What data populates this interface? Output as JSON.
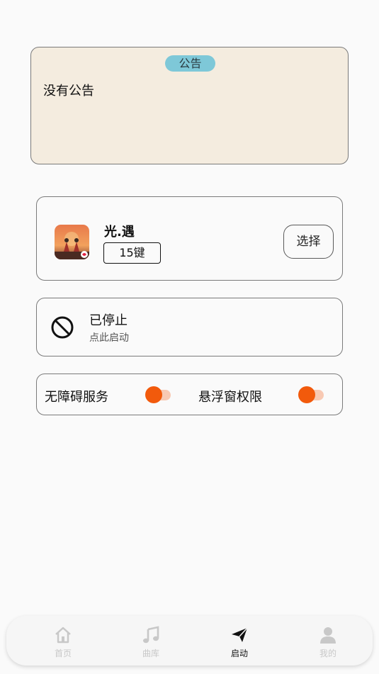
{
  "announcement": {
    "badge": "公告",
    "content": "没有公告"
  },
  "game": {
    "name": "光.遇",
    "keys": "15键",
    "select_label": "选择",
    "icon": "game-cover-icon"
  },
  "status": {
    "title": "已停止",
    "subtitle": "点此启动",
    "icon": "prohibited-icon"
  },
  "permissions": [
    {
      "label": "无障碍服务",
      "enabled": true
    },
    {
      "label": "悬浮窗权限",
      "enabled": true
    }
  ],
  "nav": [
    {
      "label": "首页",
      "icon": "home-icon",
      "active": false
    },
    {
      "label": "曲库",
      "icon": "music-note-icon",
      "active": false
    },
    {
      "label": "启动",
      "icon": "paper-plane-icon",
      "active": true
    },
    {
      "label": "我的",
      "icon": "user-icon",
      "active": false
    }
  ],
  "colors": {
    "accent": "#f25a0c",
    "badge": "#7ec8d8",
    "announce_bg": "#f4ecdf"
  }
}
